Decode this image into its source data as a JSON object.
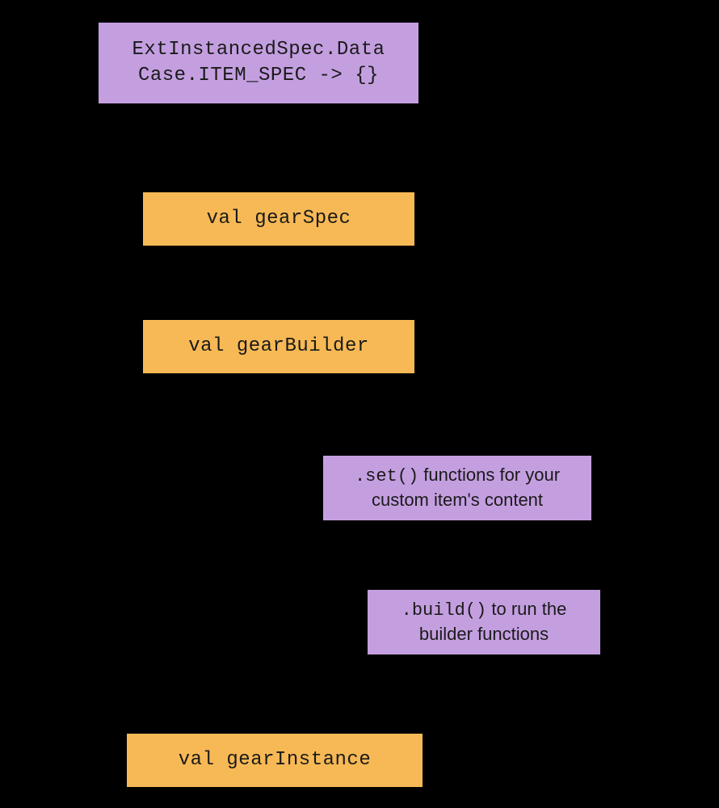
{
  "boxes": {
    "topPurple": {
      "line1": "ExtInstancedSpec.Data",
      "line2": "Case.ITEM_SPEC -> {}"
    },
    "gearSpec": "val gearSpec",
    "gearBuilder": "val gearBuilder",
    "setFns": {
      "code": ".set()",
      "text1": " functions for your",
      "text2": "custom item's content"
    },
    "buildFn": {
      "code": ".build()",
      "text1": " to run the",
      "text2": "builder functions"
    },
    "gearInstance": "val gearInstance"
  },
  "colors": {
    "purple": "#c49fe0",
    "orange": "#f7b955",
    "border": "#000000",
    "bg": "#000000"
  }
}
